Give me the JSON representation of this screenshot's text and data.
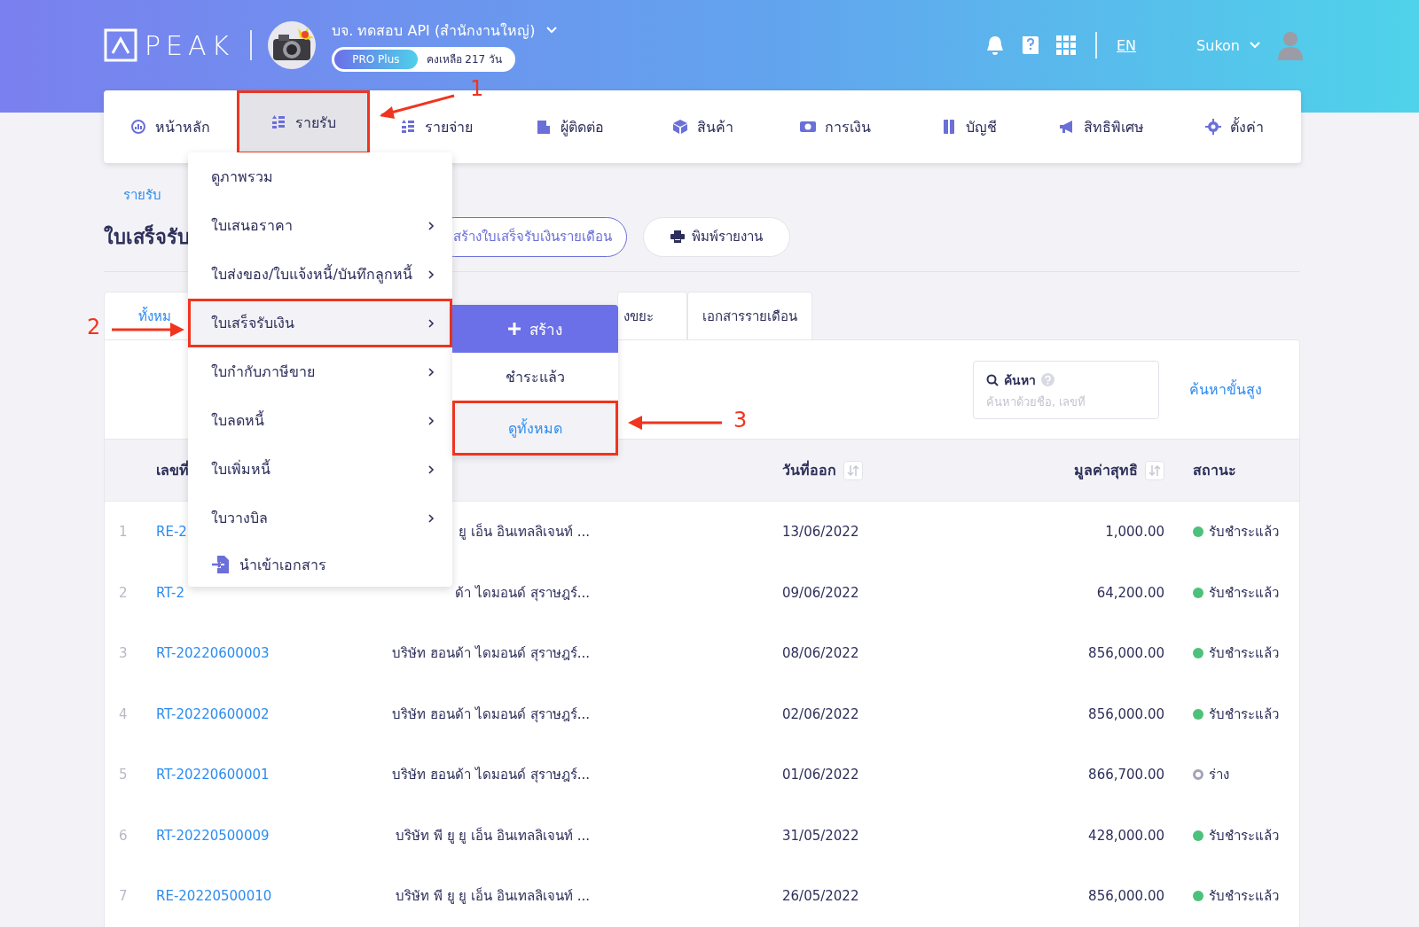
{
  "header": {
    "logo": "PEAK",
    "company": "บจ. ทดสอบ API (สำนักงานใหญ่)",
    "plan": "PRO Plus",
    "remaining": "คงเหลือ 217 วัน",
    "language": "EN",
    "user": "Sukon"
  },
  "nav": [
    {
      "label": "หน้าหลัก",
      "selected": false,
      "annotated": false
    },
    {
      "label": "รายรับ",
      "selected": true,
      "annotated": true
    },
    {
      "label": "รายจ่าย",
      "selected": false,
      "annotated": false
    },
    {
      "label": "ผู้ติดต่อ",
      "selected": false,
      "annotated": false
    },
    {
      "label": "สินค้า",
      "selected": false,
      "annotated": false
    },
    {
      "label": "การเงิน",
      "selected": false,
      "annotated": false
    },
    {
      "label": "บัญชี",
      "selected": false,
      "annotated": false
    },
    {
      "label": "สิทธิพิเศษ",
      "selected": false,
      "annotated": false
    },
    {
      "label": "ตั้งค่า",
      "selected": false,
      "annotated": false
    }
  ],
  "breadcrumb": "รายรับ",
  "page_title": "ใบเสร็จรับ",
  "actions": [
    {
      "label": "สร้างใบเสร็จรับเงินรายเดือน",
      "kind": "outline"
    },
    {
      "label": "พิมพ์รายงาน",
      "kind": "print"
    }
  ],
  "tabs": [
    {
      "label": "ทั้งหม",
      "selected": true
    },
    {
      "label": "งขยะ",
      "selected": false
    },
    {
      "label": "เอกสารรายเดือน",
      "selected": false
    }
  ],
  "search": {
    "label": "ค้นหา",
    "placeholder": "ค้นหาด้วยชื่อ, เลขที่"
  },
  "advanced_search": "ค้นหาขั้นสูง",
  "table": {
    "columns": [
      {
        "label": "เลขที่",
        "sortable": false
      },
      {
        "label": "วันที่ออก",
        "sortable": true
      },
      {
        "label": "มูลค่าสุทธิ",
        "sortable": true
      },
      {
        "label": "สถานะ",
        "sortable": false
      }
    ],
    "rows": [
      {
        "index": "1",
        "number": "RE-2",
        "customer": "ยู เอ็น อินเทลลิเจนท์ ...",
        "date": "13/06/2022",
        "amount": "1,000.00",
        "status": "รับชำระแล้ว",
        "hollow": false,
        "color": "#4cc17a"
      },
      {
        "index": "2",
        "number": "RT-2",
        "customer": "ด้า ไดมอนด์ สุราษฎร์...",
        "date": "09/06/2022",
        "amount": "64,200.00",
        "status": "รับชำระแล้ว",
        "hollow": false,
        "color": "#4cc17a"
      },
      {
        "index": "3",
        "number": "RT-20220600003",
        "customer": "บริษัท ฮอนด้า ไดมอนด์ สุราษฎร์...",
        "date": "08/06/2022",
        "amount": "856,000.00",
        "status": "รับชำระแล้ว",
        "hollow": false,
        "color": "#4cc17a"
      },
      {
        "index": "4",
        "number": "RT-20220600002",
        "customer": "บริษัท ฮอนด้า ไดมอนด์ สุราษฎร์...",
        "date": "02/06/2022",
        "amount": "856,000.00",
        "status": "รับชำระแล้ว",
        "hollow": false,
        "color": "#4cc17a"
      },
      {
        "index": "5",
        "number": "RT-20220600001",
        "customer": "บริษัท ฮอนด้า ไดมอนด์ สุราษฎร์...",
        "date": "01/06/2022",
        "amount": "866,700.00",
        "status": "ร่าง",
        "hollow": true,
        "color": "#a3a3b8"
      },
      {
        "index": "6",
        "number": "RT-20220500009",
        "customer": "บริษัท พี ยู ยู เอ็น อินเทลลิเจนท์ ...",
        "date": "31/05/2022",
        "amount": "428,000.00",
        "status": "รับชำระแล้ว",
        "hollow": false,
        "color": "#4cc17a"
      },
      {
        "index": "7",
        "number": "RE-20220500010",
        "customer": "บริษัท พี ยู ยู เอ็น อินเทลลิเจนท์ ...",
        "date": "26/05/2022",
        "amount": "856,000.00",
        "status": "รับชำระแล้ว",
        "hollow": false,
        "color": "#4cc17a"
      }
    ]
  },
  "income_menu": [
    {
      "label": "ดูภาพรวม",
      "kind": "link",
      "selected": false,
      "annotated": false
    },
    {
      "label": "ใบเสนอราคา",
      "kind": "submenu",
      "selected": false,
      "annotated": false
    },
    {
      "label": "ใบส่งของ/ใบแจ้งหนี้/บันทึกลูกหนี้",
      "kind": "submenu",
      "selected": false,
      "annotated": false
    },
    {
      "label": "ใบเสร็จรับเงิน",
      "kind": "submenu",
      "selected": true,
      "annotated": true
    },
    {
      "label": "ใบกำกับภาษีขาย",
      "kind": "submenu",
      "selected": false,
      "annotated": false
    },
    {
      "label": "ใบลดหนี้",
      "kind": "submenu",
      "selected": false,
      "annotated": false
    },
    {
      "label": "ใบเพิ่มหนี้",
      "kind": "submenu",
      "selected": false,
      "annotated": false
    },
    {
      "label": "ใบวางบิล",
      "kind": "submenu",
      "selected": false,
      "annotated": false
    },
    {
      "label": "นำเข้าเอกสาร",
      "kind": "import",
      "selected": false,
      "annotated": false
    }
  ],
  "receipt_submenu": [
    {
      "label": "สร้าง",
      "kind": "create",
      "selected": false,
      "annotated": false
    },
    {
      "label": "ชำระแล้ว",
      "kind": "item",
      "selected": false,
      "annotated": false
    },
    {
      "label": "ดูทั้งหมด",
      "kind": "item",
      "selected": true,
      "annotated": true
    }
  ],
  "annotations": [
    {
      "label": "1"
    },
    {
      "label": "2"
    },
    {
      "label": "3"
    }
  ]
}
